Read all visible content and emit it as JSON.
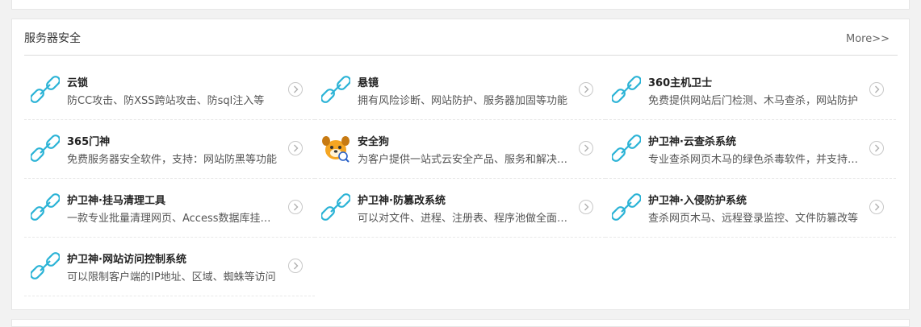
{
  "panel": {
    "title": "服务器安全",
    "more_label": "More>>"
  },
  "items": [
    {
      "name": "云锁",
      "desc": "防CC攻击、防XSS跨站攻击、防sql注入等",
      "icon": "link-icon"
    },
    {
      "name": "悬镜",
      "desc": "拥有风险诊断、网站防护、服务器加固等功能",
      "icon": "link-icon"
    },
    {
      "name": "360主机卫士",
      "desc": "免费提供网站后门检测、木马查杀，网站防护",
      "icon": "link-icon"
    },
    {
      "name": "365门神",
      "desc": "免费服务器安全软件，支持：网站防黑等功能",
      "icon": "link-icon"
    },
    {
      "name": "安全狗",
      "desc": "为客户提供一站式云安全产品、服务和解决方案",
      "icon": "safedog-logo-icon"
    },
    {
      "name": "护卫神·云查杀系统",
      "desc": "专业查杀网页木马的绿色杀毒软件，并支持云查杀",
      "icon": "link-icon"
    },
    {
      "name": "护卫神·挂马清理工具",
      "desc": "一款专业批量清理网页、Access数据库挂马工具",
      "icon": "link-icon"
    },
    {
      "name": "护卫神·防篡改系统",
      "desc": "可以对文件、进程、注册表、程序池做全面保护",
      "icon": "link-icon"
    },
    {
      "name": "护卫神·入侵防护系统",
      "desc": "查杀网页木马、远程登录监控、文件防篡改等",
      "icon": "link-icon"
    },
    {
      "name": "护卫神·网站访问控制系统",
      "desc": "可以限制客户端的IP地址、区域、蜘蛛等访问",
      "icon": "link-icon"
    }
  ],
  "colors": {
    "link_icon": "#2bb3d6",
    "border": "#e6e6e6",
    "page_bg": "#f2f2f2"
  }
}
